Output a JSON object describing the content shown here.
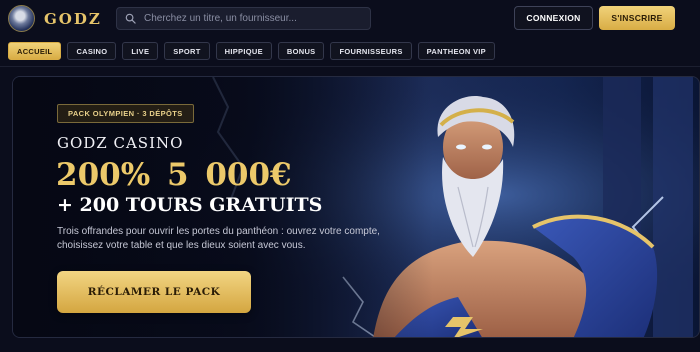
{
  "brand": {
    "name": "GODZ"
  },
  "search": {
    "placeholder": "Cherchez un titre, un fournisseur..."
  },
  "auth": {
    "login_label": "CONNEXION",
    "signup_label": "S'INSCRIRE"
  },
  "nav": {
    "tabs": [
      {
        "label": "ACCUEIL",
        "active": true
      },
      {
        "label": "CASINO"
      },
      {
        "label": "LIVE"
      },
      {
        "label": "SPORT"
      },
      {
        "label": "HIPPIQUE"
      },
      {
        "label": "BONUS"
      },
      {
        "label": "FOURNISSEURS"
      },
      {
        "label": "PANTHEON VIP"
      }
    ]
  },
  "hero": {
    "badge": "PACK OLYMPIEN · 3 DÉPÔTS",
    "title": "GODZ CASINO",
    "amount": "200% 5 000€",
    "spins": "+ 200 TOURS GRATUITS",
    "description": "Trois offrandes pour ouvrir les portes du panthéon : ouvrez votre compte, choisissez votre table et que les dieux soient avec vous.",
    "cta_label": "RÉCLAMER LE PACK"
  },
  "colors": {
    "background": "#0b0d1c",
    "gold": "#e6c46a",
    "accent_button": "#d9ad45"
  },
  "icons": {
    "search": "search-icon",
    "logo": "zeus-avatar"
  }
}
